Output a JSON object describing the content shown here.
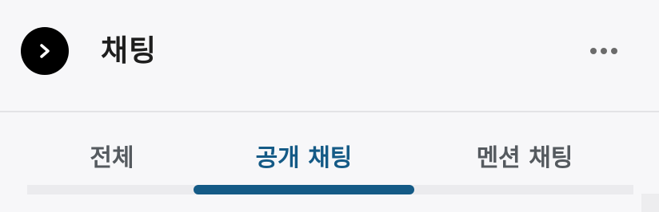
{
  "header": {
    "title": "채팅",
    "back_icon": "chevron-right-icon",
    "more_icon": "more-horizontal-icon"
  },
  "tabs": [
    {
      "label": "전체",
      "selected": false
    },
    {
      "label": "공개 채팅",
      "selected": true
    },
    {
      "label": "멘션 채팅",
      "selected": false
    }
  ],
  "colors": {
    "accent": "#145a86",
    "tab_inactive": "#555a5f",
    "title": "#1e1e1e",
    "background": "#f7f7f9"
  }
}
